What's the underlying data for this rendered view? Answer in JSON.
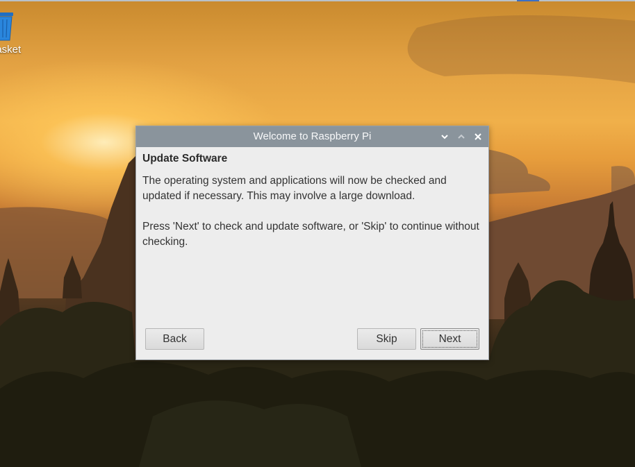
{
  "desktop": {
    "trash_label": "basket"
  },
  "dialog": {
    "title": "Welcome to Raspberry Pi",
    "heading": "Update Software",
    "paragraph_1": "The operating system and applications will now be checked and updated if necessary. This may involve a large download.",
    "paragraph_2": "Press 'Next' to check and update software, or 'Skip' to continue without checking.",
    "buttons": {
      "back": "Back",
      "skip": "Skip",
      "next": "Next"
    },
    "titlebar_controls": [
      "chevron-down-icon",
      "chevron-up-icon",
      "close-icon"
    ]
  },
  "colors": {
    "titlebar": "#8a949c",
    "dialog_bg": "#ededed",
    "sky_glow": "#f0b04a"
  }
}
